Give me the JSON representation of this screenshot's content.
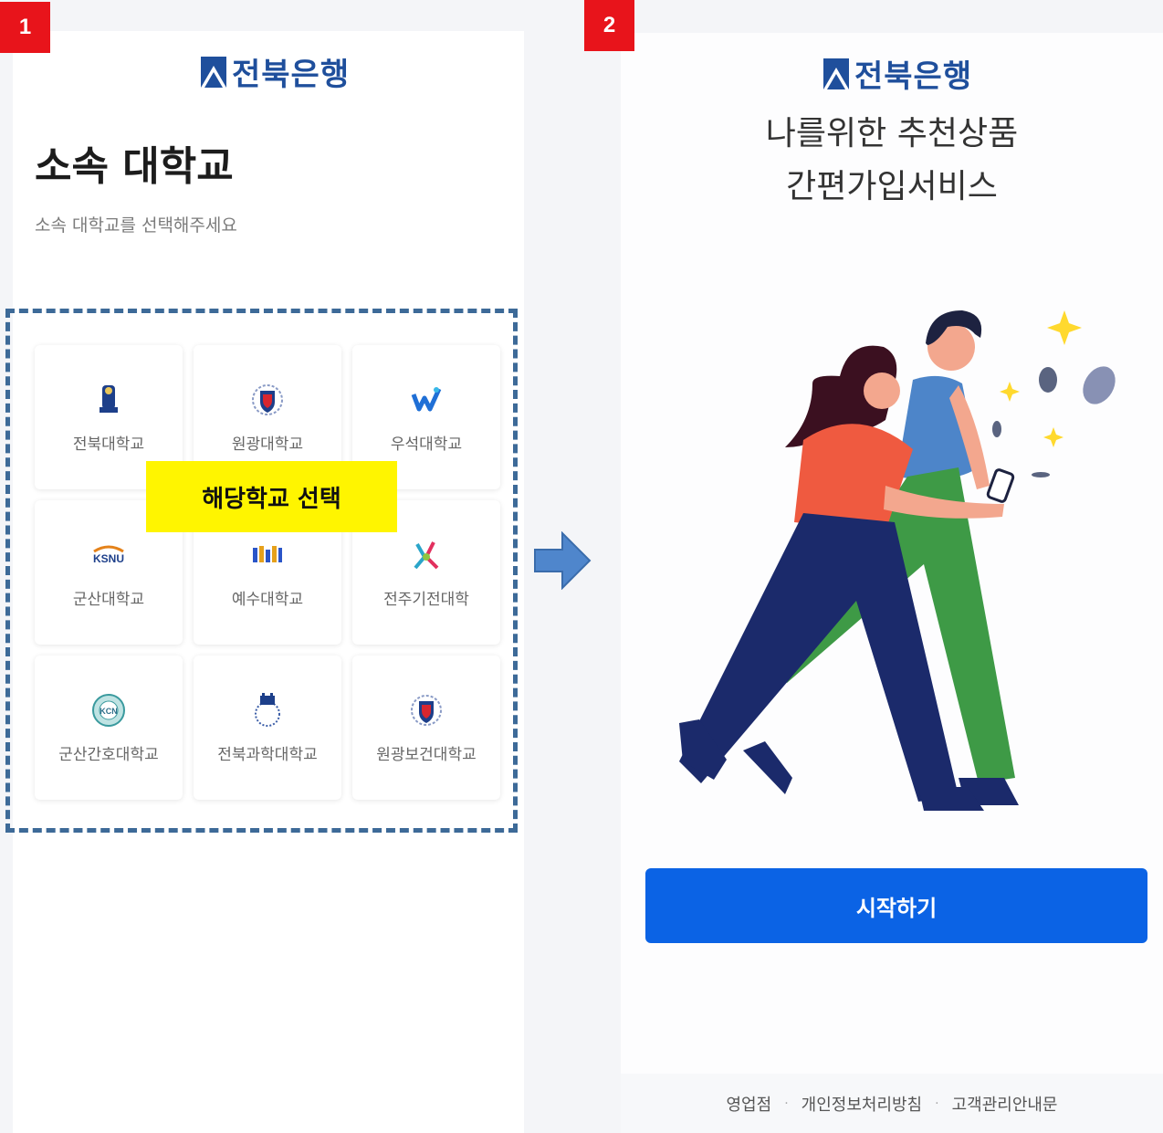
{
  "step1": {
    "badge": "1"
  },
  "step2": {
    "badge": "2"
  },
  "left": {
    "logo_text": "전북은행",
    "title": "소속 대학교",
    "subtitle": "소속 대학교를 선택해주세요",
    "universities": [
      {
        "name": "전북대학교",
        "icon": "jbnu-logo-icon"
      },
      {
        "name": "원광대학교",
        "icon": "wonkwang-logo-icon"
      },
      {
        "name": "우석대학교",
        "icon": "woosuk-logo-icon"
      },
      {
        "name": "군산대학교",
        "icon": "ksnu-logo-icon"
      },
      {
        "name": "예수대학교",
        "icon": "jesus-univ-logo-icon"
      },
      {
        "name": "전주기전대학",
        "icon": "kijeon-logo-icon"
      },
      {
        "name": "군산간호대학교",
        "icon": "kcn-logo-icon"
      },
      {
        "name": "전북과학대학교",
        "icon": "jbsc-logo-icon"
      },
      {
        "name": "원광보건대학교",
        "icon": "wkhc-logo-icon"
      }
    ],
    "callout": "해당학교 선택",
    "colors": {
      "dash": "#3d6a98",
      "callout_bg": "#fff500"
    }
  },
  "right": {
    "logo_text": "전북은행",
    "headline_line1": "나를위한 추천상품",
    "headline_line2": "간편가입서비스",
    "start_button": "시작하기",
    "footer_links": [
      "영업점",
      "개인정보처리방침",
      "고객관리안내문"
    ],
    "colors": {
      "button": "#0b63e5"
    }
  },
  "arrow_icon": "right-arrow-icon",
  "badge_color": "#e8141b"
}
